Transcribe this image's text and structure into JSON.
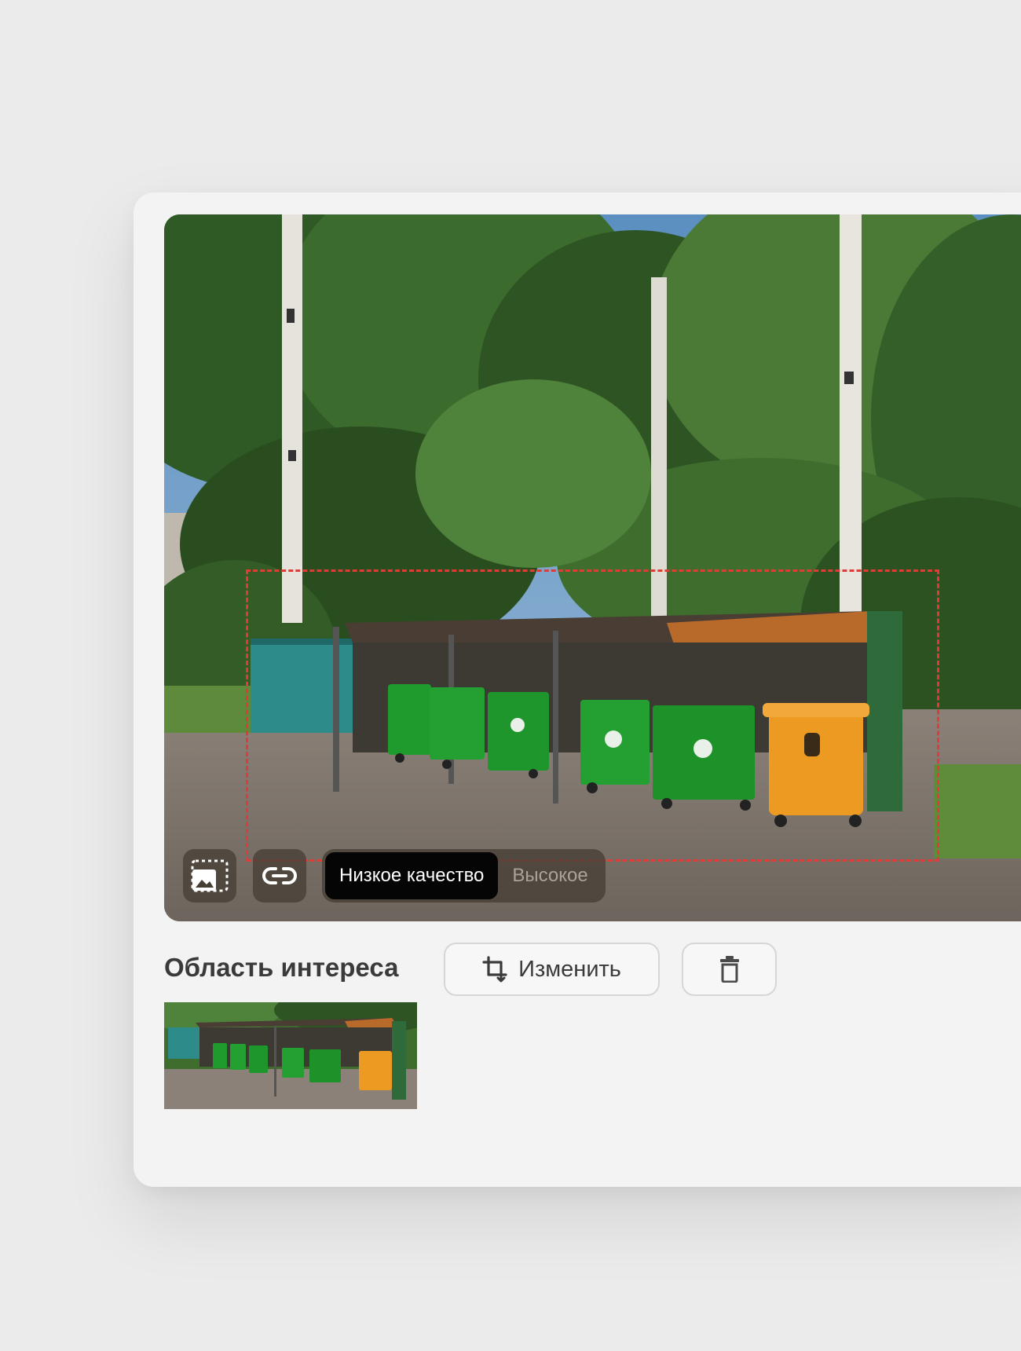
{
  "roi_panel": {
    "title": "Область интереса",
    "edit_label": "Изменить"
  },
  "quality_toggle": {
    "low_label": "Низкое качество",
    "high_label": "Высокое",
    "selected": "low"
  },
  "icons": {
    "image_region": "image-region-icon",
    "link": "link-icon",
    "crop": "crop-icon",
    "trash": "trash-icon"
  },
  "colors": {
    "roi_outline": "#e53935",
    "active_toggle": "#050505"
  }
}
